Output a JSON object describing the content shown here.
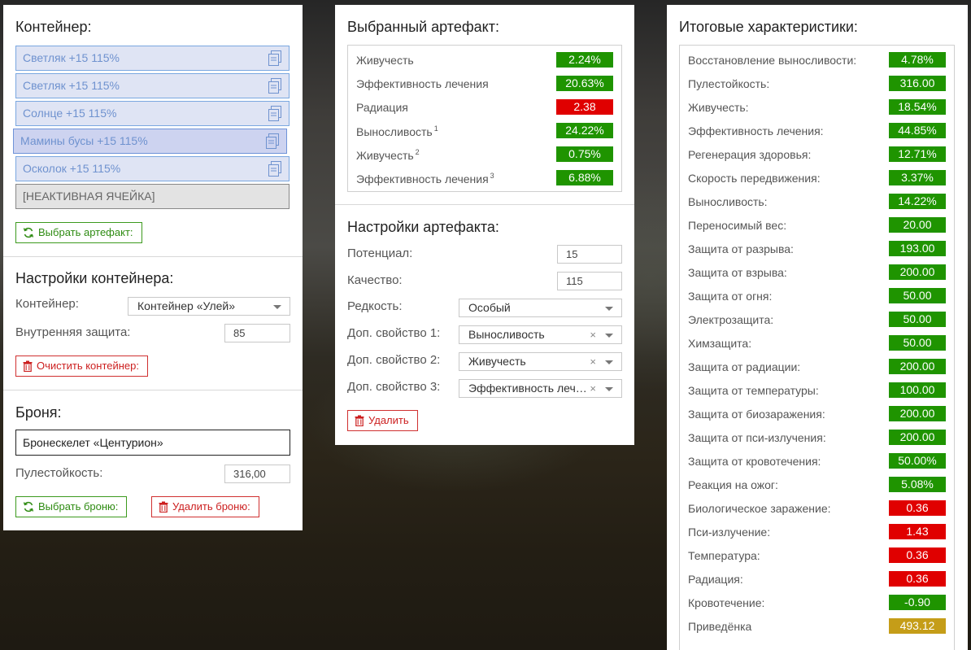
{
  "colors": {
    "green": "#1f9400",
    "red": "#e00000",
    "gold": "#c59d18"
  },
  "container": {
    "title": "Контейнер:",
    "slots": [
      {
        "label": "Светляк +15 115%",
        "icon": "copy-icon"
      },
      {
        "label": "Светляк +15 115%",
        "icon": "copy-icon"
      },
      {
        "label": "Солнце +15 115%",
        "icon": "copy-icon"
      },
      {
        "label": "Мамины бусы +15 115%",
        "icon": "copy-icon"
      },
      {
        "label": "Осколок +15 115%",
        "icon": "copy-icon"
      },
      {
        "label": "[НЕАКТИВНАЯ ЯЧЕЙКА]"
      }
    ],
    "choose_artifact_label": "Выбрать артефакт:"
  },
  "container_settings": {
    "title": "Настройки контейнера:",
    "container_label": "Контейнер:",
    "container_value": "Контейнер «Улей»",
    "inner_protection_label": "Внутренняя защита:",
    "inner_protection_value": "85",
    "clear_label": "Очистить контейнер:"
  },
  "armor": {
    "title": "Броня:",
    "name": "Бронескелет «Центурион»",
    "bullet_resistance_label": "Пулестойкость:",
    "bullet_resistance_value": "316,00",
    "choose_label": "Выбрать броню:",
    "delete_label": "Удалить броню:"
  },
  "selected_artifact": {
    "title": "Выбранный артефакт:",
    "stats": [
      {
        "label": "Живучесть",
        "sup": "",
        "value": "2.24%",
        "color": "green"
      },
      {
        "label": "Эффективность лечения",
        "sup": "",
        "value": "20.63%",
        "color": "green"
      },
      {
        "label": "Радиация",
        "sup": "",
        "value": "2.38",
        "color": "red"
      },
      {
        "label": "Выносливость",
        "sup": "1",
        "value": "24.22%",
        "color": "green"
      },
      {
        "label": "Живучесть",
        "sup": "2",
        "value": "0.75%",
        "color": "green"
      },
      {
        "label": "Эффективность лечения",
        "sup": "3",
        "value": "6.88%",
        "color": "green"
      }
    ]
  },
  "artifact_settings": {
    "title": "Настройки артефакта:",
    "potential_label": "Потенциал:",
    "potential_value": "15",
    "quality_label": "Качество:",
    "quality_value": "115",
    "rarity_label": "Редкость:",
    "rarity_value": "Особый",
    "extra1_label": "Доп. свойство 1:",
    "extra1_value": "Выносливость",
    "extra2_label": "Доп. свойство 2:",
    "extra2_value": "Живучесть",
    "extra3_label": "Доп. свойство 3:",
    "extra3_value": "Эффективность лечения",
    "clear_symbol": "×",
    "delete_label": "Удалить"
  },
  "totals": {
    "title": "Итоговые характеристики:",
    "stats": [
      {
        "label": "Восстановление выносливости:",
        "value": "4.78%",
        "color": "green"
      },
      {
        "label": "Пулестойкость:",
        "value": "316.00",
        "color": "green"
      },
      {
        "label": "Живучесть:",
        "value": "18.54%",
        "color": "green"
      },
      {
        "label": "Эффективность лечения:",
        "value": "44.85%",
        "color": "green"
      },
      {
        "label": "Регенерация здоровья:",
        "value": "12.71%",
        "color": "green"
      },
      {
        "label": "Скорость передвижения:",
        "value": "3.37%",
        "color": "green"
      },
      {
        "label": "Выносливость:",
        "value": "14.22%",
        "color": "green"
      },
      {
        "label": "Переносимый вес:",
        "value": "20.00",
        "color": "green"
      },
      {
        "label": "Защита от разрыва:",
        "value": "193.00",
        "color": "green"
      },
      {
        "label": "Защита от взрыва:",
        "value": "200.00",
        "color": "green"
      },
      {
        "label": "Защита от огня:",
        "value": "50.00",
        "color": "green"
      },
      {
        "label": "Электрозащита:",
        "value": "50.00",
        "color": "green"
      },
      {
        "label": "Химзащита:",
        "value": "50.00",
        "color": "green"
      },
      {
        "label": "Защита от радиации:",
        "value": "200.00",
        "color": "green"
      },
      {
        "label": "Защита от температуры:",
        "value": "100.00",
        "color": "green"
      },
      {
        "label": "Защита от биозаражения:",
        "value": "200.00",
        "color": "green"
      },
      {
        "label": "Защита от пси-излучения:",
        "value": "200.00",
        "color": "green"
      },
      {
        "label": "Защита от кровотечения:",
        "value": "50.00%",
        "color": "green"
      },
      {
        "label": "Реакция на ожог:",
        "value": "5.08%",
        "color": "green"
      },
      {
        "label": "Биологическое заражение:",
        "value": "0.36",
        "color": "red"
      },
      {
        "label": "Пси-излучение:",
        "value": "1.43",
        "color": "red"
      },
      {
        "label": "Температура:",
        "value": "0.36",
        "color": "red"
      },
      {
        "label": "Радиация:",
        "value": "0.36",
        "color": "red"
      },
      {
        "label": "Кровотечение:",
        "value": "-0.90",
        "color": "green"
      },
      {
        "label": "Приведёнка",
        "value": "493.12",
        "color": "gold"
      }
    ]
  }
}
